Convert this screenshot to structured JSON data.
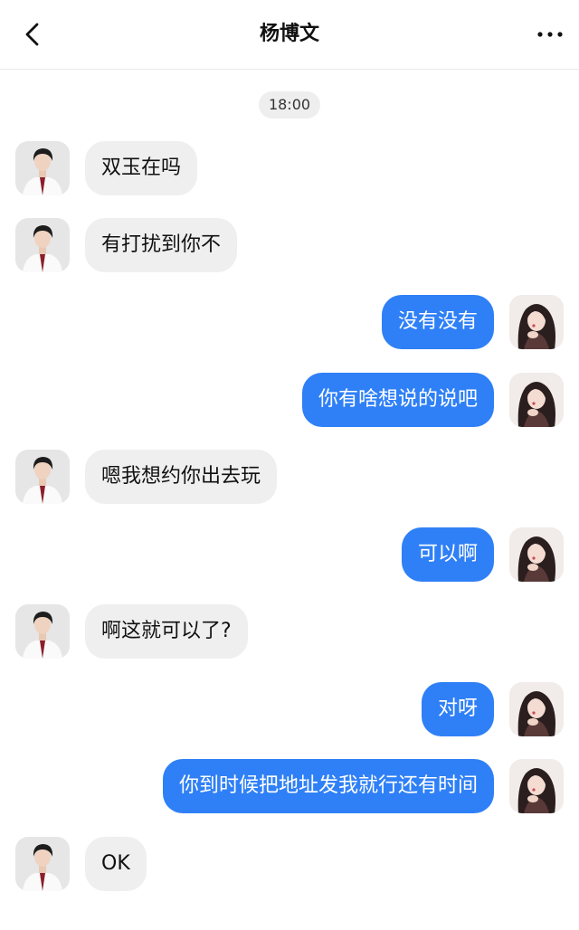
{
  "header": {
    "title": "杨博文",
    "back_icon": "chevron-left-icon",
    "more_icon": "more-dots-icon"
  },
  "timestamp": "18:00",
  "colors": {
    "incoming_bubble": "#efefef",
    "outgoing_bubble": "#2f80f6",
    "outgoing_text": "#ffffff",
    "incoming_text": "#111111"
  },
  "messages": [
    {
      "sender": "other",
      "text": "双玉在吗"
    },
    {
      "sender": "other",
      "text": "有打扰到你不"
    },
    {
      "sender": "me",
      "text": "没有没有"
    },
    {
      "sender": "me",
      "text": "你有啥想说的说吧"
    },
    {
      "sender": "other",
      "text": "嗯我想约你出去玩"
    },
    {
      "sender": "me",
      "text": "可以啊"
    },
    {
      "sender": "other",
      "text": "啊这就可以了?"
    },
    {
      "sender": "me",
      "text": "对呀"
    },
    {
      "sender": "me",
      "text": "你到时候把地址发我就行还有时间"
    },
    {
      "sender": "other",
      "text": "OK"
    }
  ]
}
